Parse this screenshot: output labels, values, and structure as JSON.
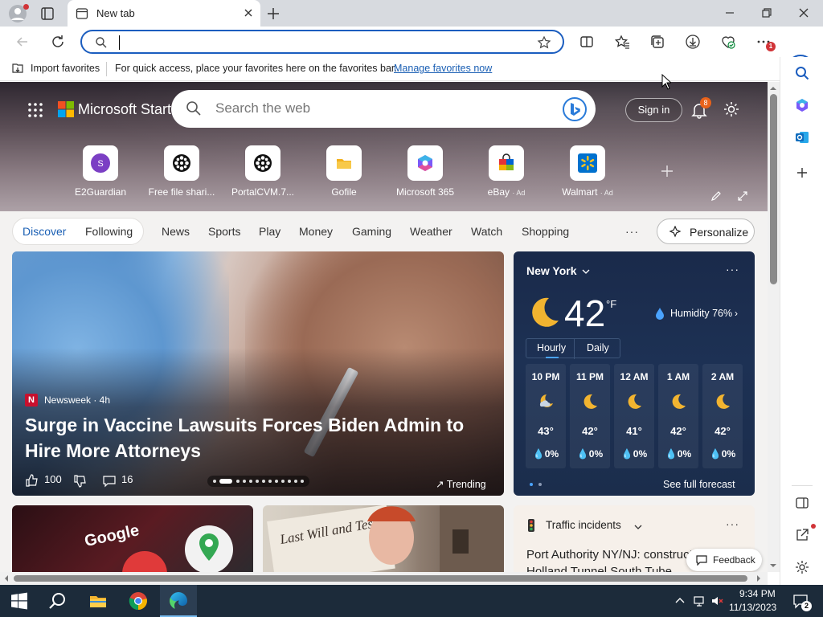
{
  "browser": {
    "tab_title": "New tab",
    "address_value": "",
    "favorites_bar": {
      "import_label": "Import favorites",
      "message": "For quick access, place your favorites here on the favorites bar.",
      "manage_link": "Manage favorites now"
    },
    "download_badge": "1"
  },
  "start": {
    "brand": "Microsoft Start",
    "search_placeholder": "Search the web",
    "signin_label": "Sign in",
    "notification_count": "8",
    "quick_links": [
      {
        "label": "E2Guardian",
        "ad": "",
        "icon": "letter-s-icon",
        "color": "#7b3fc4"
      },
      {
        "label": "Free file shari...",
        "ad": "",
        "icon": "film-reel-icon",
        "color": "#111111"
      },
      {
        "label": "PortalCVM.7...",
        "ad": "",
        "icon": "film-reel-icon",
        "color": "#111111"
      },
      {
        "label": "Gofile",
        "ad": "",
        "icon": "folder-icon",
        "color": "#f2b01e"
      },
      {
        "label": "Microsoft 365",
        "ad": "",
        "icon": "m365-icon",
        "color": "#7a5af8"
      },
      {
        "label": "eBay",
        "ad": "· Ad",
        "icon": "shopping-bag-icon",
        "color": "#e53238"
      },
      {
        "label": "Walmart",
        "ad": "· Ad",
        "icon": "walmart-spark-icon",
        "color": "#0071ce"
      }
    ],
    "feed_tabs": {
      "active": "Discover",
      "following": "Following",
      "tabs": [
        "News",
        "Sports",
        "Play",
        "Money",
        "Gaming",
        "Weather",
        "Watch",
        "Shopping"
      ],
      "more": "···",
      "personalize": "Personalize"
    },
    "main_story": {
      "source": "Newsweek · 4h",
      "source_initial": "N",
      "title": "Surge in Vaccine Lawsuits Forces Biden Admin to Hire More Attorneys",
      "likes": "100",
      "comments": "16",
      "trending": "Trending"
    },
    "weather": {
      "location": "New York",
      "more": "···",
      "temp": "42",
      "unit": "°F",
      "humidity": "Humidity 76%",
      "tab_hourly": "Hourly",
      "tab_daily": "Daily",
      "hours": [
        {
          "time": "10 PM",
          "temp": "43°",
          "precip": "0%",
          "icon": "partly-cloudy-night-icon"
        },
        {
          "time": "11 PM",
          "temp": "42°",
          "precip": "0%",
          "icon": "crescent-moon-icon"
        },
        {
          "time": "12 AM",
          "temp": "41°",
          "precip": "0%",
          "icon": "crescent-moon-icon"
        },
        {
          "time": "1 AM",
          "temp": "42°",
          "precip": "0%",
          "icon": "crescent-moon-icon"
        },
        {
          "time": "2 AM",
          "temp": "42°",
          "precip": "0%",
          "icon": "crescent-moon-icon"
        }
      ],
      "forecast_link": "See full forecast"
    },
    "traffic": {
      "label": "Traffic incidents",
      "more": "···",
      "headline": "Port Authority NY/NJ: construction on Holland Tunnel South Tube"
    },
    "google_card_text": "Google",
    "will_card_text": "Last Will and Testament",
    "feedback_label": "Feedback"
  },
  "taskbar": {
    "time": "9:34 PM",
    "date": "11/13/2023",
    "notification_count": "2"
  },
  "colors": {
    "accent": "#1b5dbf",
    "weather_bg": "#1d3154",
    "taskbar_bg": "#1c2b3a"
  }
}
